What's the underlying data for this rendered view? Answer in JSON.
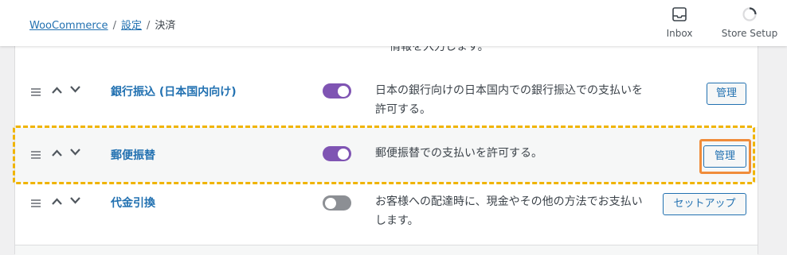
{
  "breadcrumb": {
    "root": "WooCommerce",
    "separator": "/",
    "settings": "設定",
    "current": "決済"
  },
  "header_actions": [
    {
      "label": "Inbox",
      "icon": "inbox-icon"
    },
    {
      "label": "Store Setup",
      "icon": "spinner-icon"
    }
  ],
  "partial_text": "情報を入力します。",
  "methods": [
    {
      "name": "銀行振込 (日本国内向け)",
      "enabled": true,
      "description": "日本の銀行向けの日本国内での銀行振込での支払いを許可する。",
      "action": "管理"
    },
    {
      "name": "郵便振替",
      "enabled": true,
      "description": "郵便振替での支払いを許可する。",
      "action": "管理"
    },
    {
      "name": "代金引換",
      "enabled": false,
      "description": "お客様への配達時に、現金やその他の方法でお支払いします。",
      "action": "セットアップ"
    }
  ],
  "colors": {
    "accent": "#2271b1",
    "toggle_on": "#7f54b3",
    "highlight_dashed": "#f0b400",
    "highlight_solid": "#f08c3a"
  }
}
